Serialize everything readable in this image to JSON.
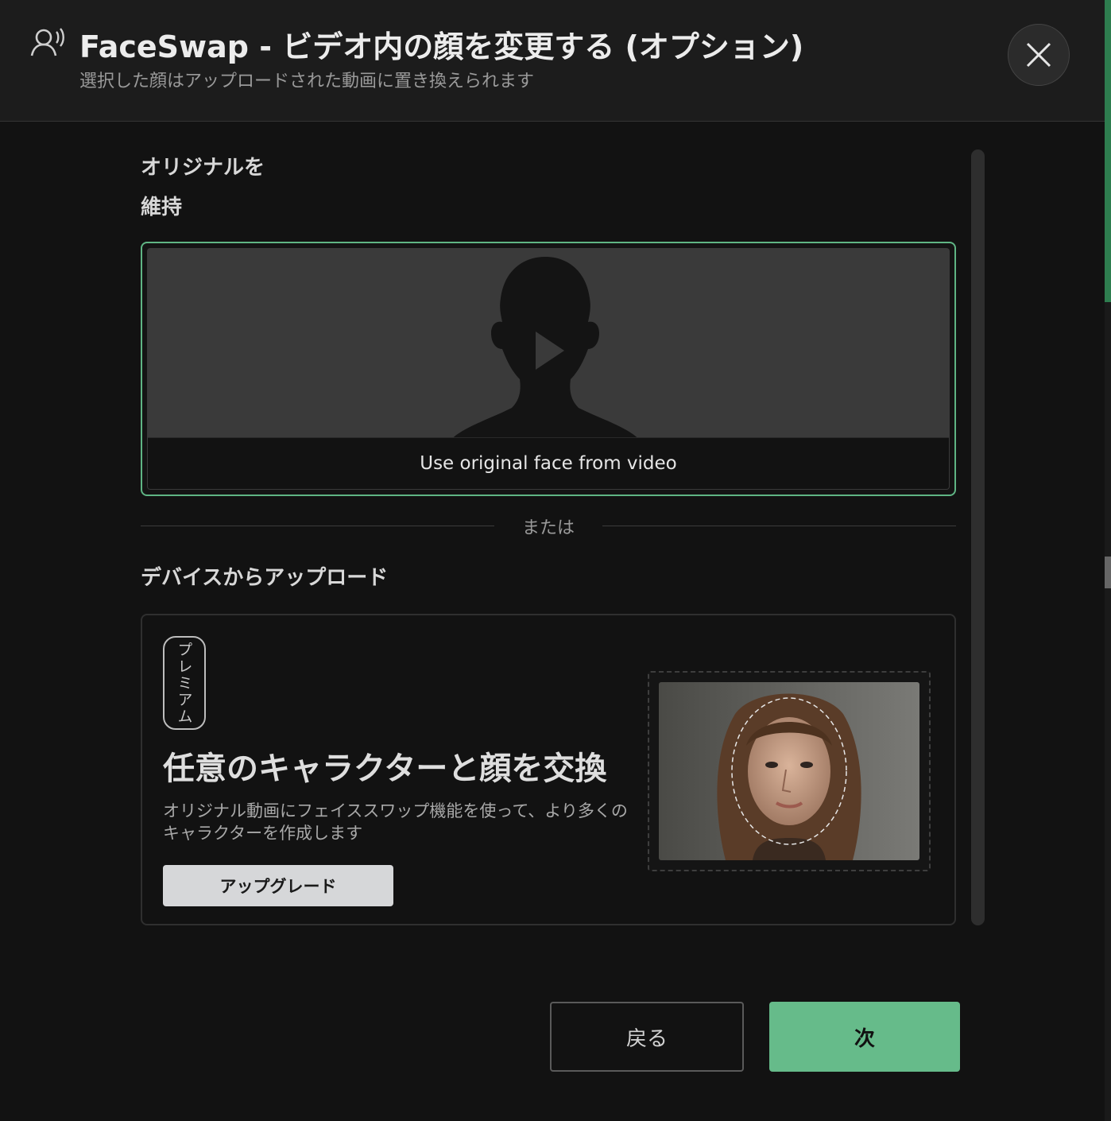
{
  "header": {
    "title": "FaceSwap - ビデオ内の顔を変更する (オプション)",
    "subtitle": "選択した顔はアップロードされた動画に置き換えられます",
    "icon": "person-voice-icon",
    "close_icon": "close-icon"
  },
  "keep_original": {
    "title_line1": "オリジナルを",
    "title_line2": "維持",
    "card_caption": "Use original face from video",
    "icon": "play-icon"
  },
  "divider": {
    "text": "または"
  },
  "upload": {
    "title": "デバイスからアップロード",
    "badge": "プレミアム",
    "heading": "任意のキャラクターと顔を交換",
    "description": "オリジナル動画にフェイススワップ機能を使って、より多くのキャラクターを作成します",
    "upgrade_label": "アップグレード"
  },
  "footer": {
    "back_label": "戻る",
    "next_label": "次"
  },
  "colors": {
    "accent": "#66bb8a",
    "selected_border": "#5fb584",
    "background": "#121212"
  }
}
